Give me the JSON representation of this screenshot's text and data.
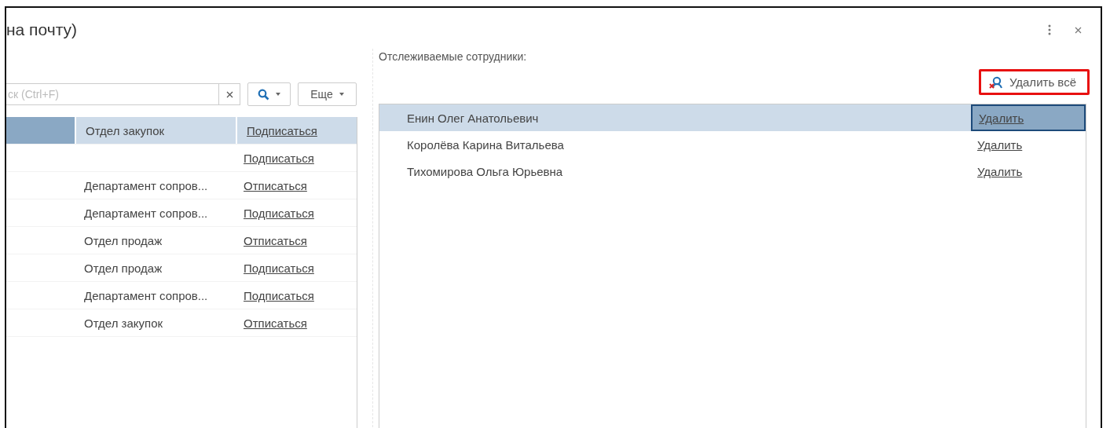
{
  "window": {
    "title": "на почту)"
  },
  "left_panel": {
    "search": {
      "placeholder": "ск (Ctrl+F)"
    },
    "more_button": "Еще",
    "rows": [
      {
        "column_2": "Отдел закупок",
        "column_3": "Подписаться",
        "selected": true
      },
      {
        "column_3": "Подписаться",
        "selected": false
      },
      {
        "column_2": "Департамент сопров...",
        "column_3": "Отписаться",
        "selected": false
      },
      {
        "column_2": "Департамент сопров...",
        "column_3": "Подписаться",
        "selected": false
      },
      {
        "column_2": "Отдел продаж",
        "column_3": "Отписаться",
        "selected": false
      },
      {
        "column_2": "Отдел продаж",
        "column_3": "Подписаться",
        "selected": false
      },
      {
        "column_2": "Департамент сопров...",
        "column_3": "Подписаться",
        "selected": false
      },
      {
        "column_2": "Отдел закупок",
        "column_3": "Отписаться",
        "selected": false
      }
    ]
  },
  "tracked_employees": {
    "label": "Отслеживаемые сотрудники:",
    "remove_all": {
      "label": "Удалить всё",
      "highlighted": true
    },
    "rows": [
      {
        "name": "Енин Олег Анатольевич",
        "action": "Удалить",
        "selected": true
      },
      {
        "name": "Королёва Карина Витальева",
        "action": "Удалить",
        "selected": false
      },
      {
        "name": "Тихомирова Ольга Юрьевна",
        "action": "Удалить",
        "selected": false
      }
    ]
  }
}
